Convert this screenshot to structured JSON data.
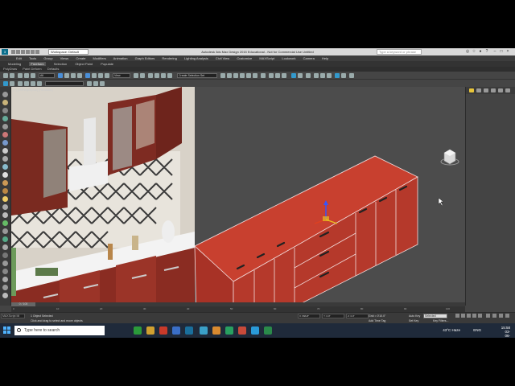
{
  "titlebar": {
    "app_icon": "3ds-max-icon",
    "workspace": "Workspace: Default",
    "title": "Autodesk 3ds Max Design 2015  Educational - Not for Commercial Use   Untitled",
    "search_placeholder": "Type a keyword or phrase"
  },
  "menu": [
    "Edit",
    "Tools",
    "Group",
    "Views",
    "Create",
    "Modifiers",
    "Animation",
    "Graph Editors",
    "Rendering",
    "Lighting Analysis",
    "Civil View",
    "Customize",
    "MAXScript",
    "Lookwork",
    "Camera",
    "Help"
  ],
  "ribbon_tabs": [
    "Modeling",
    "Freeform",
    "Selection",
    "Object Paint",
    "Populate"
  ],
  "ribbon_active": "Freeform",
  "subtabs": [
    "PolyDraw",
    "Paint Deform",
    "Defaults"
  ],
  "toolbar": {
    "filter": "All",
    "viewport_mode": "View",
    "selection_set": "Create Selection Set"
  },
  "viewport": {
    "label": "[+] [Orthographic] [Realistic]",
    "reference_image": "kitchen-reference-image",
    "model": "red-kitchen-cabinet-model"
  },
  "timeline": {
    "frame": "0 / 100",
    "ticks": [
      "0",
      "10",
      "20",
      "30",
      "40",
      "50",
      "60",
      "70",
      "80",
      "90",
      "100"
    ]
  },
  "status": {
    "maxscript": "MAXScript Mi",
    "selected": "1 Object Selected",
    "hint": "Click and drag to select and move objects",
    "x": "X: 896.8\"",
    "y": "Y: 0.0\"",
    "z": "Z: 0.0\"",
    "grid": "Grid = 0'10.0\"",
    "add_time_tag": "Add Time Tag",
    "auto_key": "Auto Key",
    "set_key": "Set Key",
    "selection_dropdown": "Selected",
    "key_filters": "Key Filters..."
  },
  "taskbar": {
    "search_placeholder": "Type here to search",
    "weather": "43°C  Haze",
    "language": "ENG",
    "time": "15:58",
    "date": "03-06-2022"
  },
  "colors": {
    "cabinet": "#c0392b",
    "cabinet_dark": "#8e2a20",
    "viewport_bg": "#4c4c4c"
  }
}
